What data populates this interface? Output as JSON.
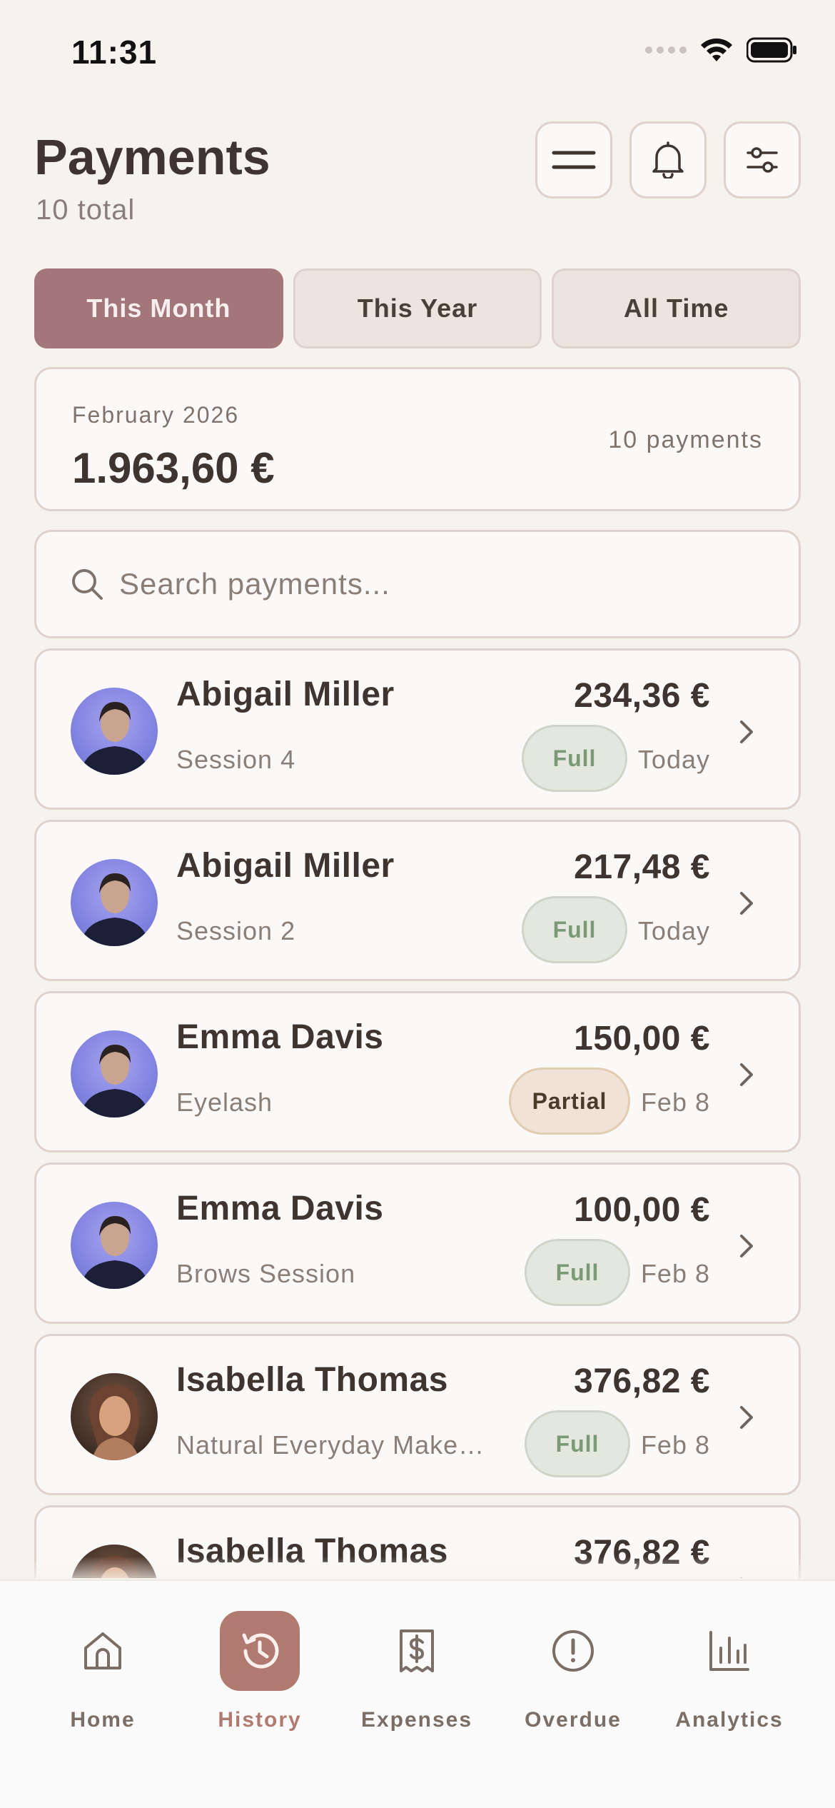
{
  "status_bar": {
    "time": "11:31"
  },
  "header": {
    "title": "Payments",
    "subtitle": "10 total",
    "buttons": [
      "menu-icon",
      "bell-icon",
      "filter-icon"
    ]
  },
  "segments": [
    {
      "label": "This Month",
      "active": true
    },
    {
      "label": "This Year",
      "active": false
    },
    {
      "label": "All Time",
      "active": false
    }
  ],
  "summary": {
    "period": "February 2026",
    "total": "1.963,60 €",
    "count": "10 payments"
  },
  "search": {
    "placeholder": "Search payments..."
  },
  "payments": [
    {
      "name": "Abigail Miller",
      "service": "Session 4",
      "amount": "234,36 €",
      "status": "Full",
      "date": "Today",
      "avatar": "avatar-blue"
    },
    {
      "name": "Abigail Miller",
      "service": "Session 2",
      "amount": "217,48 €",
      "status": "Full",
      "date": "Today",
      "avatar": "avatar-blue"
    },
    {
      "name": "Emma Davis",
      "service": "Eyelash",
      "amount": "150,00 €",
      "status": "Partial",
      "date": "Feb 8",
      "avatar": "avatar-blue"
    },
    {
      "name": "Emma Davis",
      "service": "Brows Session",
      "amount": "100,00 €",
      "status": "Full",
      "date": "Feb 8",
      "avatar": "avatar-blue"
    },
    {
      "name": "Isabella Thomas",
      "service": "Natural Everyday Make…",
      "amount": "376,82 €",
      "status": "Full",
      "date": "Feb 8",
      "avatar": "avatar-brown"
    },
    {
      "name": "Isabella Thomas",
      "service": "",
      "amount": "376,82 €",
      "status": "",
      "date": "",
      "avatar": "avatar-brown"
    }
  ],
  "tabbar": [
    {
      "label": "Home",
      "icon": "home-icon",
      "active": false
    },
    {
      "label": "History",
      "icon": "history-icon",
      "active": true
    },
    {
      "label": "Expenses",
      "icon": "receipt-icon",
      "active": false
    },
    {
      "label": "Overdue",
      "icon": "alert-icon",
      "active": false
    },
    {
      "label": "Analytics",
      "icon": "chart-icon",
      "active": false
    }
  ],
  "colors": {
    "background": "#f6f3ef",
    "accent": "#a3767a",
    "tab_active": "#b07a70",
    "badge_full": "#7a9a76",
    "badge_partial": "#4a3a2a"
  }
}
